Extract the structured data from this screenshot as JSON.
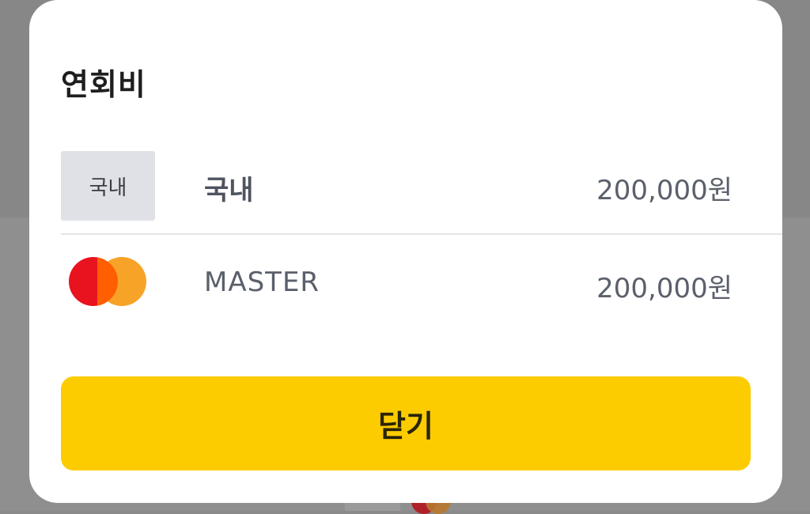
{
  "sheet": {
    "title": "연회비",
    "rows": [
      {
        "badge": "국내",
        "name": "국내",
        "amount": "200,000원"
      },
      {
        "icon": "mastercard-icon",
        "name": "MASTER",
        "amount": "200,000원"
      }
    ],
    "close_label": "닫기"
  },
  "colors": {
    "accent": "#FDCC00",
    "badge_bg": "#DFE1E7",
    "mastercard_red": "#E8131F",
    "mastercard_orange": "#F79E1B"
  }
}
